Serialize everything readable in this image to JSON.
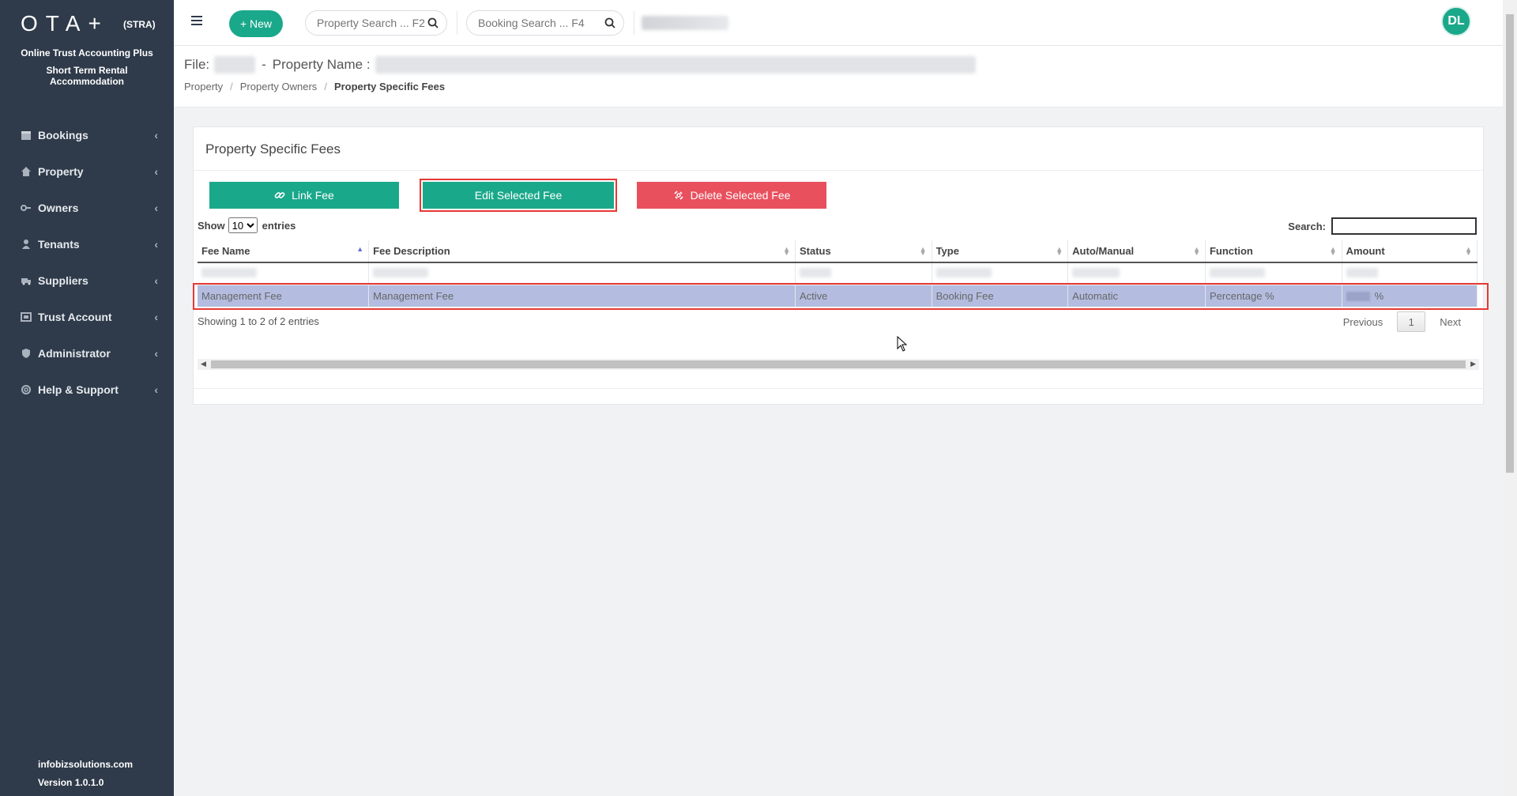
{
  "sidebar": {
    "logo": "OTA+",
    "logo_tag": "(STRA)",
    "brand_line_1": "Online Trust Accounting Plus",
    "brand_line_2": "Short Term Rental",
    "brand_line_3": "Accommodation",
    "items": [
      {
        "label": "Bookings",
        "icon": "calendar-icon"
      },
      {
        "label": "Property",
        "icon": "home-icon"
      },
      {
        "label": "Owners",
        "icon": "key-icon"
      },
      {
        "label": "Tenants",
        "icon": "user-icon"
      },
      {
        "label": "Suppliers",
        "icon": "truck-icon"
      },
      {
        "label": "Trust Account",
        "icon": "bank-icon"
      },
      {
        "label": "Administrator",
        "icon": "shield-icon"
      },
      {
        "label": "Help & Support",
        "icon": "lifebuoy-icon"
      }
    ],
    "footer_site": "infobizsolutions.com",
    "footer_version": "Version 1.0.1.0"
  },
  "topbar": {
    "new_label": "+ New",
    "property_search_placeholder": "Property Search ... F2",
    "booking_search_placeholder": "Booking Search ... F4",
    "avatar_initials": "DL"
  },
  "header": {
    "file_label": "File:",
    "dash": "-",
    "property_name_label": "Property  Name :",
    "breadcrumb": [
      "Property",
      "Property Owners",
      "Property Specific Fees"
    ]
  },
  "card": {
    "title": "Property Specific Fees",
    "link_fee": "Link Fee",
    "edit_fee": "Edit Selected Fee",
    "delete_fee": "Delete Selected Fee",
    "show_label": "Show",
    "entries_value": "10",
    "entries_label": "entries",
    "search_label": "Search:",
    "columns": [
      "Fee Name",
      "Fee Description",
      "Status",
      "Type",
      "Auto/Manual",
      "Function",
      "Amount"
    ],
    "selected_row": {
      "fee_name": "Management Fee",
      "fee_description": "Management Fee",
      "status": "Active",
      "type": "Booking Fee",
      "auto_manual": "Automatic",
      "function": "Percentage %",
      "amount_suffix": "%"
    },
    "info": "Showing 1 to 2 of 2 entries",
    "pager_prev": "Previous",
    "pager_current": "1",
    "pager_next": "Next"
  },
  "colors": {
    "sidebar_bg": "#2f3b4a",
    "accent": "#1aa88a",
    "danger": "#e9505e",
    "highlight_outline": "#e53935",
    "selected_row": "#b4bde0"
  }
}
